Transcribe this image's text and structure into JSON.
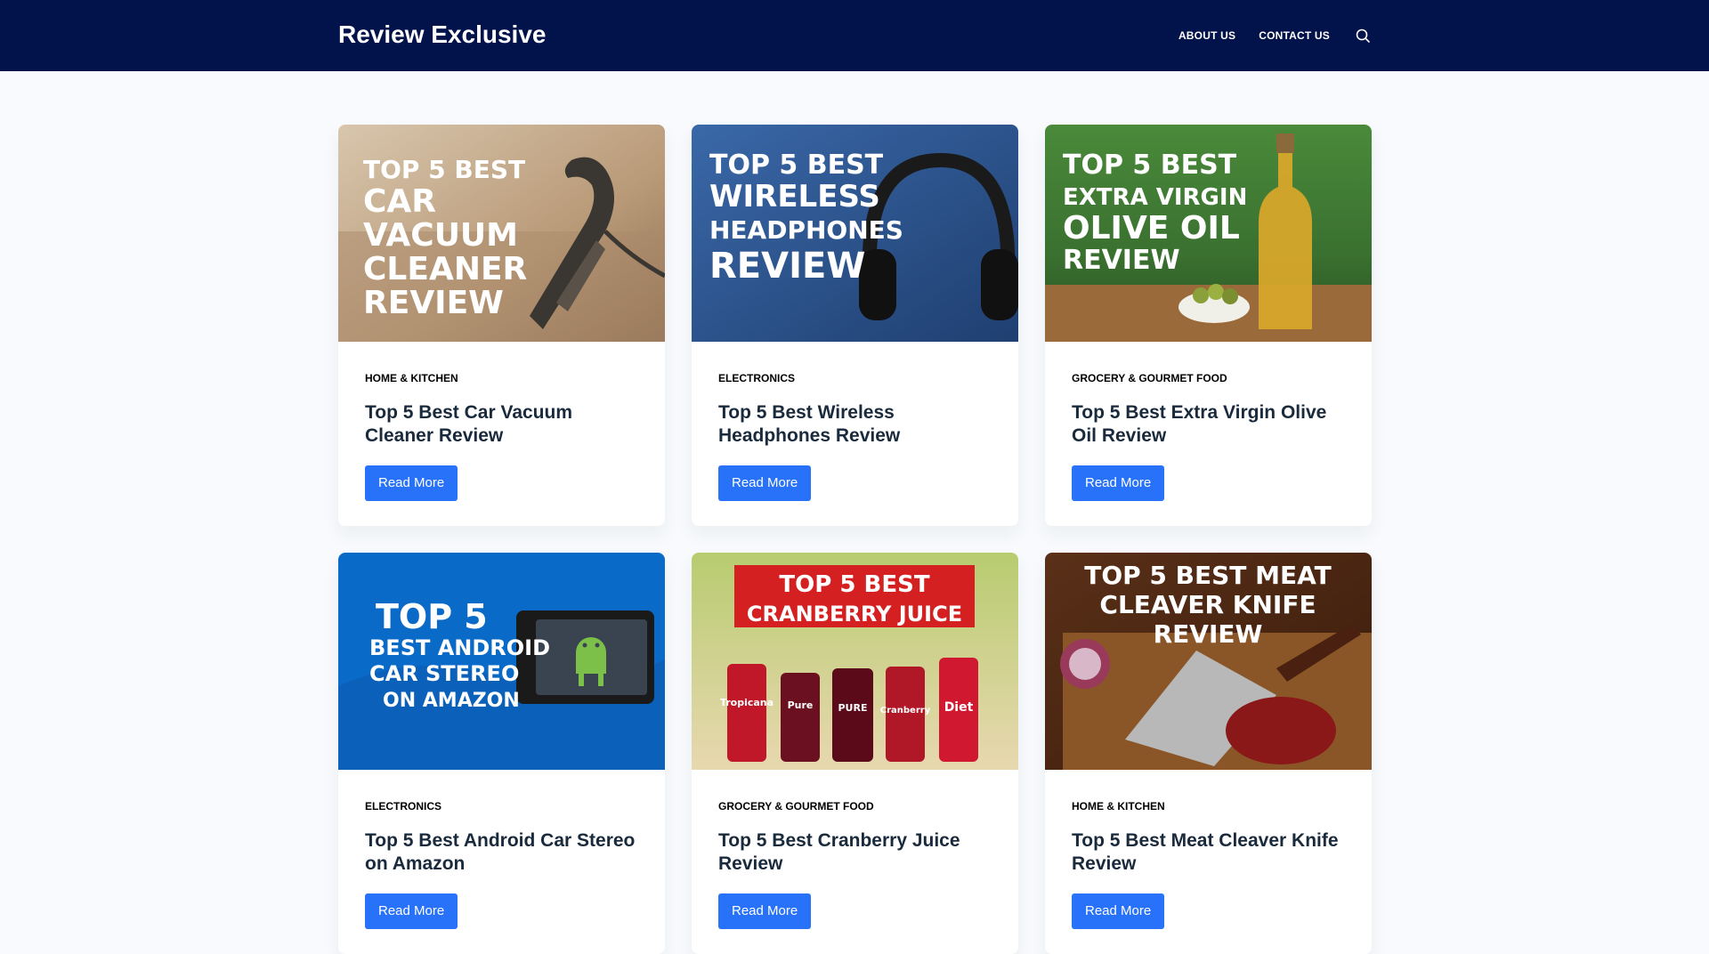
{
  "header": {
    "site_title": "Review Exclusive",
    "nav": [
      "ABOUT US",
      "CONTACT US"
    ],
    "search_icon": "search-icon"
  },
  "colors": {
    "header_bg": "#02124a",
    "accent": "#2872fa",
    "page_bg": "#f8fafd"
  },
  "posts": [
    {
      "category": "HOME & KITCHEN",
      "title": "Top 5 Best Car Vacuum Cleaner Review",
      "button": "Read More",
      "image_text": [
        "TOP 5 BEST",
        "CAR",
        "VACUUM",
        "CLEANER",
        "REVIEW"
      ]
    },
    {
      "category": "ELECTRONICS",
      "title": "Top 5 Best Wireless Headphones Review",
      "button": "Read More",
      "image_text": [
        "TOP 5 BEST",
        "WIRELESS",
        "HEADPHONES",
        "REVIEW"
      ]
    },
    {
      "category": "GROCERY & GOURMET FOOD",
      "title": "Top 5 Best Extra Virgin Olive Oil Review",
      "button": "Read More",
      "image_text": [
        "TOP 5 BEST",
        "EXTRA VIRGIN",
        "OLIVE OIL",
        "REVIEW"
      ]
    },
    {
      "category": "ELECTRONICS",
      "title": "Top 5 Best Android Car Stereo on Amazon",
      "button": "Read More",
      "image_text": [
        "TOP 5",
        "BEST ANDROID",
        "CAR STEREO",
        "ON AMAZON"
      ]
    },
    {
      "category": "GROCERY & GOURMET FOOD",
      "title": "Top 5 Best Cranberry Juice Review",
      "button": "Read More",
      "image_text": [
        "TOP 5 BEST",
        "CRANBERRY JUICE"
      ],
      "bottle_labels": [
        "Tropicana",
        "Pure",
        "PURE",
        "Cranberry",
        "Diet"
      ]
    },
    {
      "category": "HOME & KITCHEN",
      "title": "Top 5 Best Meat Cleaver Knife Review",
      "button": "Read More",
      "image_text": [
        "TOP 5 BEST MEAT",
        "CLEAVER KNIFE",
        "REVIEW"
      ]
    }
  ]
}
